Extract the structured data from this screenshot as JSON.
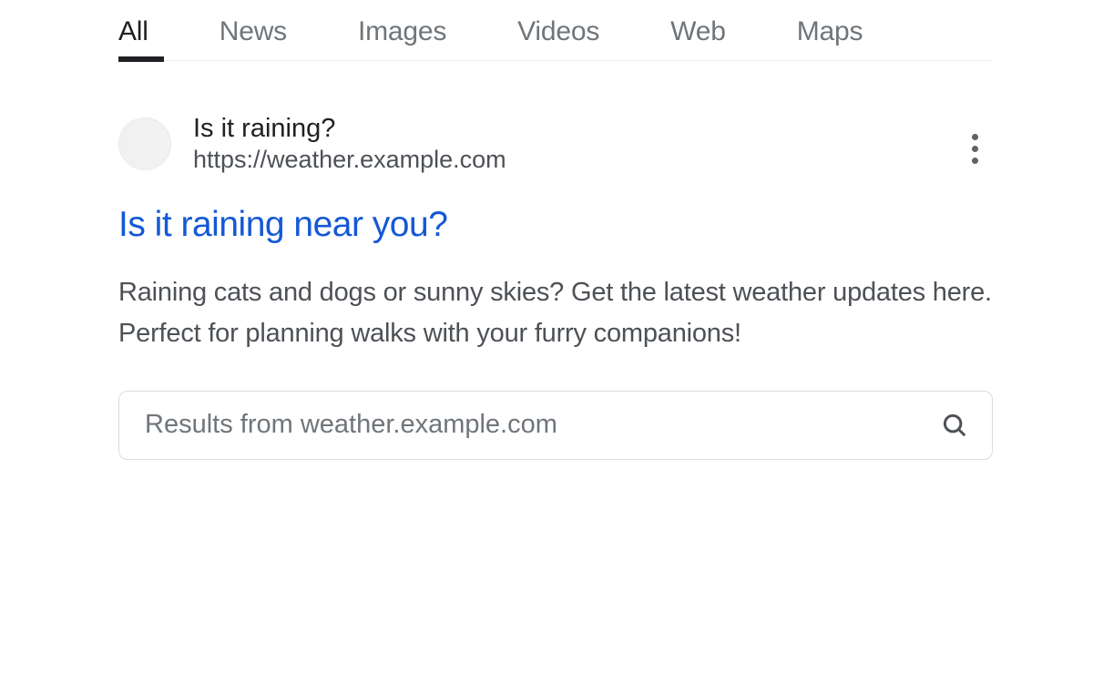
{
  "tabs": [
    {
      "label": "All",
      "active": true
    },
    {
      "label": "News",
      "active": false
    },
    {
      "label": "Images",
      "active": false
    },
    {
      "label": "Videos",
      "active": false
    },
    {
      "label": "Web",
      "active": false
    },
    {
      "label": "Maps",
      "active": false
    }
  ],
  "result": {
    "site_name": "Is it raining?",
    "site_url": "https://weather.example.com",
    "title": "Is it raining near you?",
    "snippet": "Raining cats and dogs or sunny skies? Get the latest weather updates here. Perfect for planning walks with your furry companions!",
    "site_search_placeholder": "Results from weather.example.com"
  }
}
